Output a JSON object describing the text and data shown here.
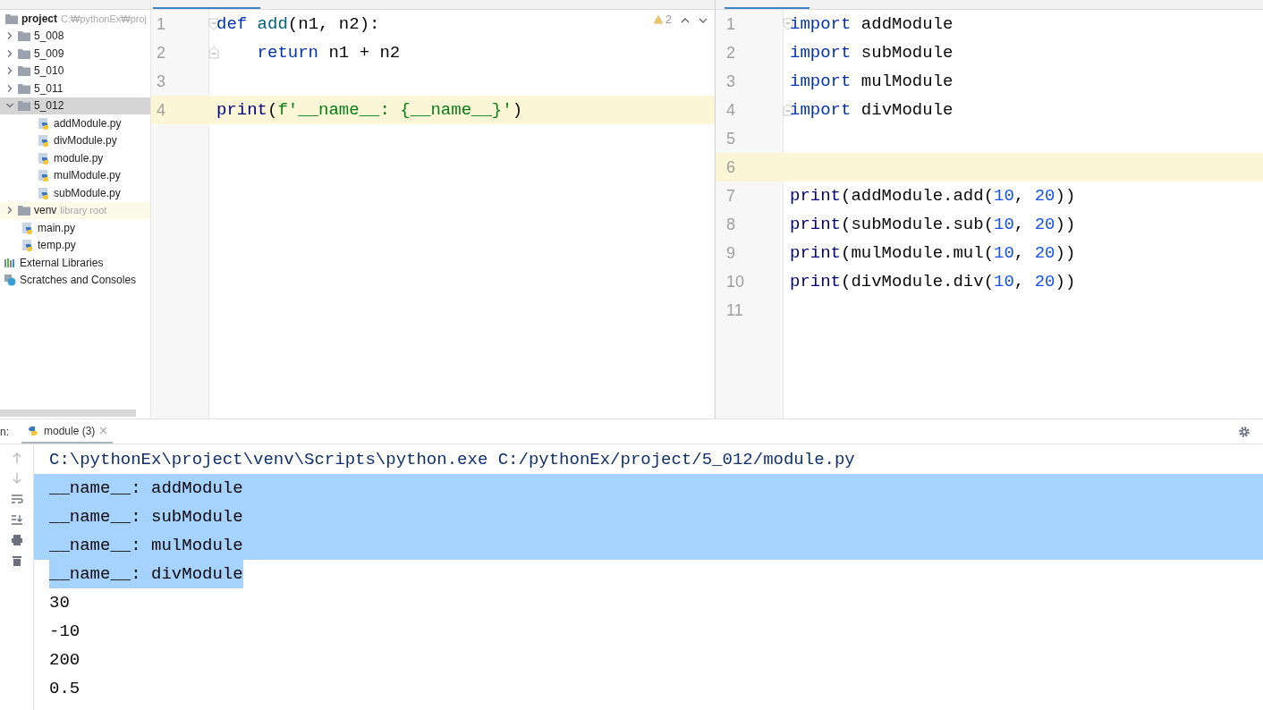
{
  "project_tree": {
    "root": {
      "label": "project",
      "path": "C:₩pythonEx₩proj"
    },
    "items": [
      {
        "kind": "folder",
        "label": "5_008",
        "expanded": false,
        "selected": false
      },
      {
        "kind": "folder",
        "label": "5_009",
        "expanded": false,
        "selected": false
      },
      {
        "kind": "folder",
        "label": "5_010",
        "expanded": false,
        "selected": false
      },
      {
        "kind": "folder",
        "label": "5_011",
        "expanded": false,
        "selected": false
      },
      {
        "kind": "folder",
        "label": "5_012",
        "expanded": true,
        "selected": true,
        "children": [
          {
            "kind": "file",
            "label": "addModule.py",
            "selected": false
          },
          {
            "kind": "file",
            "label": "divModule.py",
            "selected": false
          },
          {
            "kind": "file",
            "label": "module.py",
            "selected": false
          },
          {
            "kind": "file",
            "label": "mulModule.py",
            "selected": false
          },
          {
            "kind": "file",
            "label": "subModule.py",
            "selected": false
          }
        ]
      },
      {
        "kind": "library_folder",
        "label": "venv",
        "hint": "library root",
        "expanded": false,
        "selected": false
      },
      {
        "kind": "file",
        "label": "main.py",
        "selected": false
      },
      {
        "kind": "file",
        "label": "temp.py",
        "selected": false
      }
    ],
    "extras": [
      {
        "kind": "libraries",
        "label": "External Libraries"
      },
      {
        "kind": "scratches",
        "label": "Scratches and Consoles"
      }
    ]
  },
  "left_editor": {
    "warnings": "2",
    "lines": [
      {
        "number": "1",
        "current": false,
        "fold_start": true,
        "fold_end": false,
        "tokens": [
          {
            "kind": "keyword",
            "text": "def "
          },
          {
            "kind": "function",
            "text": "add"
          },
          {
            "kind": "plain",
            "text": "(n1, n2):"
          }
        ]
      },
      {
        "number": "2",
        "current": false,
        "fold_start": false,
        "fold_end": true,
        "tokens": [
          {
            "kind": "keyword",
            "text": "    return"
          },
          {
            "kind": "plain",
            "text": " n1 + n2"
          }
        ]
      },
      {
        "number": "3",
        "current": false,
        "fold_start": false,
        "fold_end": false
      },
      {
        "number": "4",
        "current": true,
        "fold_start": false,
        "fold_end": false,
        "tokens": [
          {
            "kind": "builtin",
            "text": "print"
          },
          {
            "kind": "plain",
            "text": "("
          },
          {
            "kind": "string",
            "text": "f'__name__: {__name__}'"
          },
          {
            "kind": "plain",
            "text": ")"
          }
        ]
      }
    ]
  },
  "right_editor": {
    "lines": [
      {
        "number": "1",
        "current": false,
        "fold_start": true,
        "fold_end": false,
        "tokens": [
          {
            "kind": "keyword",
            "text": "import"
          },
          {
            "kind": "plain",
            "text": " addModule"
          }
        ]
      },
      {
        "number": "2",
        "current": false,
        "fold_start": false,
        "fold_end": false,
        "tokens": [
          {
            "kind": "keyword",
            "text": "import"
          },
          {
            "kind": "plain",
            "text": " subModule"
          }
        ]
      },
      {
        "number": "3",
        "current": false,
        "fold_start": false,
        "fold_end": false,
        "tokens": [
          {
            "kind": "keyword",
            "text": "import"
          },
          {
            "kind": "plain",
            "text": " mulModule"
          }
        ]
      },
      {
        "number": "4",
        "current": false,
        "fold_start": false,
        "fold_end": true,
        "tokens": [
          {
            "kind": "keyword",
            "text": "import"
          },
          {
            "kind": "plain",
            "text": " divModule"
          }
        ]
      },
      {
        "number": "5",
        "current": false,
        "fold_start": false,
        "fold_end": false
      },
      {
        "number": "6",
        "current": true,
        "fold_start": false,
        "fold_end": false
      },
      {
        "number": "7",
        "current": false,
        "fold_start": false,
        "fold_end": false,
        "tokens": [
          {
            "kind": "builtin",
            "text": "print"
          },
          {
            "kind": "plain",
            "text": "(addModule.add("
          },
          {
            "kind": "number",
            "text": "10"
          },
          {
            "kind": "plain",
            "text": ", "
          },
          {
            "kind": "number",
            "text": "20"
          },
          {
            "kind": "plain",
            "text": "))"
          }
        ]
      },
      {
        "number": "8",
        "current": false,
        "fold_start": false,
        "fold_end": false,
        "tokens": [
          {
            "kind": "builtin",
            "text": "print"
          },
          {
            "kind": "plain",
            "text": "(subModule.sub("
          },
          {
            "kind": "number",
            "text": "10"
          },
          {
            "kind": "plain",
            "text": ", "
          },
          {
            "kind": "number",
            "text": "20"
          },
          {
            "kind": "plain",
            "text": "))"
          }
        ]
      },
      {
        "number": "9",
        "current": false,
        "fold_start": false,
        "fold_end": false,
        "tokens": [
          {
            "kind": "builtin",
            "text": "print"
          },
          {
            "kind": "plain",
            "text": "(mulModule.mul("
          },
          {
            "kind": "number",
            "text": "10"
          },
          {
            "kind": "plain",
            "text": ", "
          },
          {
            "kind": "number",
            "text": "20"
          },
          {
            "kind": "plain",
            "text": "))"
          }
        ]
      },
      {
        "number": "10",
        "current": false,
        "fold_start": false,
        "fold_end": false,
        "tokens": [
          {
            "kind": "builtin",
            "text": "print"
          },
          {
            "kind": "plain",
            "text": "(divModule.div("
          },
          {
            "kind": "number",
            "text": "10"
          },
          {
            "kind": "plain",
            "text": ", "
          },
          {
            "kind": "number",
            "text": "20"
          },
          {
            "kind": "plain",
            "text": "))"
          }
        ]
      },
      {
        "number": "11",
        "current": false,
        "fold_start": false,
        "fold_end": false
      }
    ]
  },
  "run_panel": {
    "label": "n:",
    "tab": {
      "label": "module (3)",
      "selected": true
    },
    "lines": [
      {
        "kind": "command",
        "text": "C:\\pythonEx\\project\\venv\\Scripts\\python.exe C:/pythonEx/project/5_012/module.py",
        "selected": false
      },
      {
        "kind": "output",
        "text": "__name__: addModule",
        "selected": true
      },
      {
        "kind": "output",
        "text": "__name__: subModule",
        "selected": true
      },
      {
        "kind": "output",
        "text": "__name__: mulModule",
        "selected": true
      },
      {
        "kind": "output",
        "text": "__name__: divModule",
        "selected": true
      },
      {
        "kind": "output",
        "text": "30",
        "selected": false
      },
      {
        "kind": "output",
        "text": "-10",
        "selected": false
      },
      {
        "kind": "output",
        "text": "200",
        "selected": false
      },
      {
        "kind": "output",
        "text": "0.5",
        "selected": false
      }
    ]
  }
}
